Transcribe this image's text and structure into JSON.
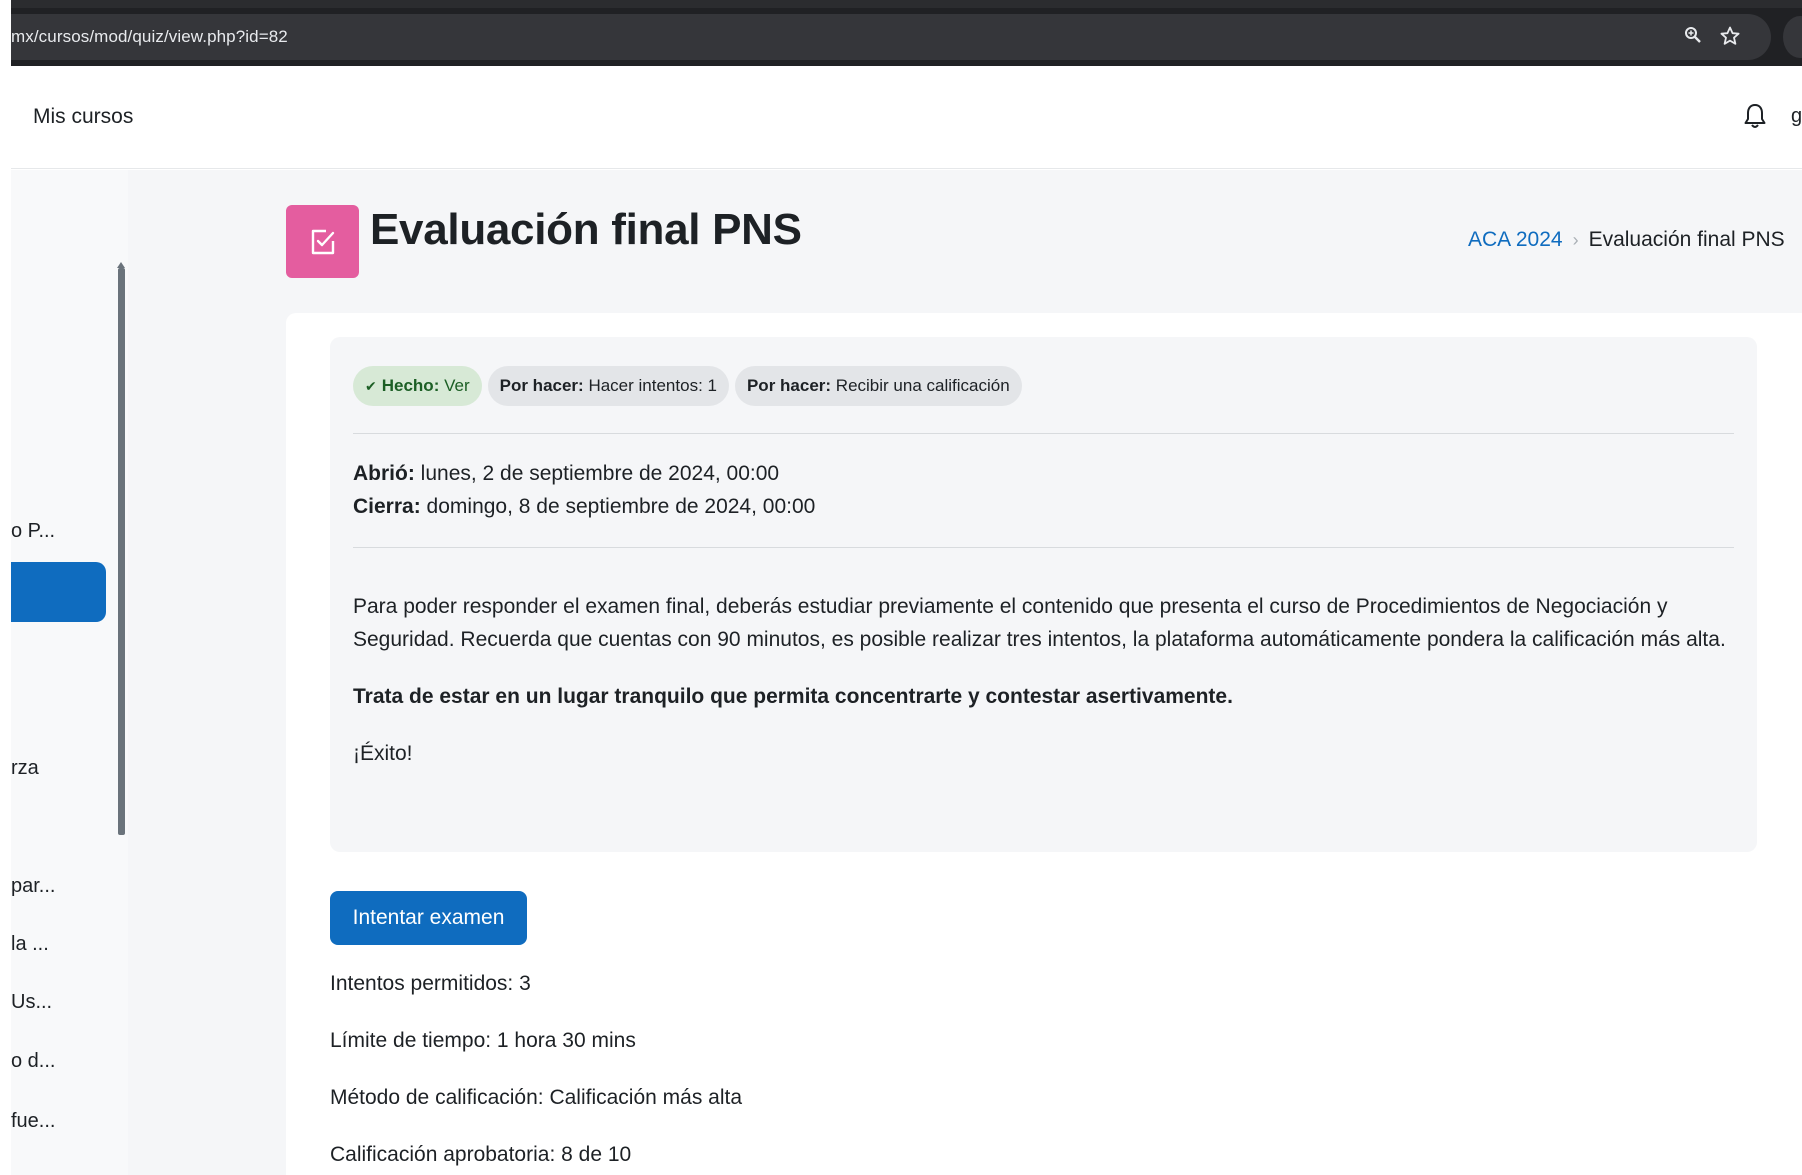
{
  "browser": {
    "url": "mx/cursos/mod/quiz/view.php?id=82",
    "zoom_icon": "zoom-icon",
    "star_icon": "star-icon"
  },
  "navbar": {
    "my_courses": "Mis cursos",
    "bell_icon": "bell-icon",
    "cut_text": "g"
  },
  "drawer": {
    "items": [
      "o P...",
      "rza",
      "par...",
      "la ...",
      "Us...",
      "o d...",
      "fue..."
    ]
  },
  "header": {
    "icon": "quiz-icon",
    "title": "Evaluación final PNS",
    "breadcrumb": [
      "ACA 2024",
      "Evaluación final PNS"
    ],
    "accent_color": "#e45d9f"
  },
  "completion": {
    "done": {
      "label": "Hecho:",
      "text": "Ver"
    },
    "todo1": {
      "label": "Por hacer:",
      "text": "Hacer intentos: 1"
    },
    "todo2": {
      "label": "Por hacer:",
      "text": "Recibir una calificación"
    }
  },
  "dates": {
    "opened_label": "Abrió:",
    "opened_value": "lunes, 2 de septiembre de 2024, 00:00",
    "closes_label": "Cierra:",
    "closes_value": "domingo, 8 de septiembre de 2024, 00:00"
  },
  "description": {
    "p1": "Para poder responder el examen final, deberás estudiar previamente el contenido que presenta el curso de Procedimientos de Negociación y Seguridad. Recuerda que cuentas con 90 minutos, es posible realizar tres intentos, la plataforma automáticamente pondera la calificación más alta.",
    "p2": "Trata de estar en un lugar tranquilo que permita concentrarte y contestar asertivamente.",
    "p3": "¡Éxito!"
  },
  "quiz": {
    "attempt_button": "Intentar examen",
    "attempts_allowed": "Intentos permitidos: 3",
    "time_limit": "Límite de tiempo: 1 hora 30 mins",
    "grading_method": "Método de calificación: Calificación más alta",
    "passing_grade": "Calificación aprobatoria: 8 de 10"
  },
  "colors": {
    "primary": "#0f6cbf",
    "done_badge_bg": "#d7e9d6",
    "done_badge_text": "#1c5f25"
  }
}
